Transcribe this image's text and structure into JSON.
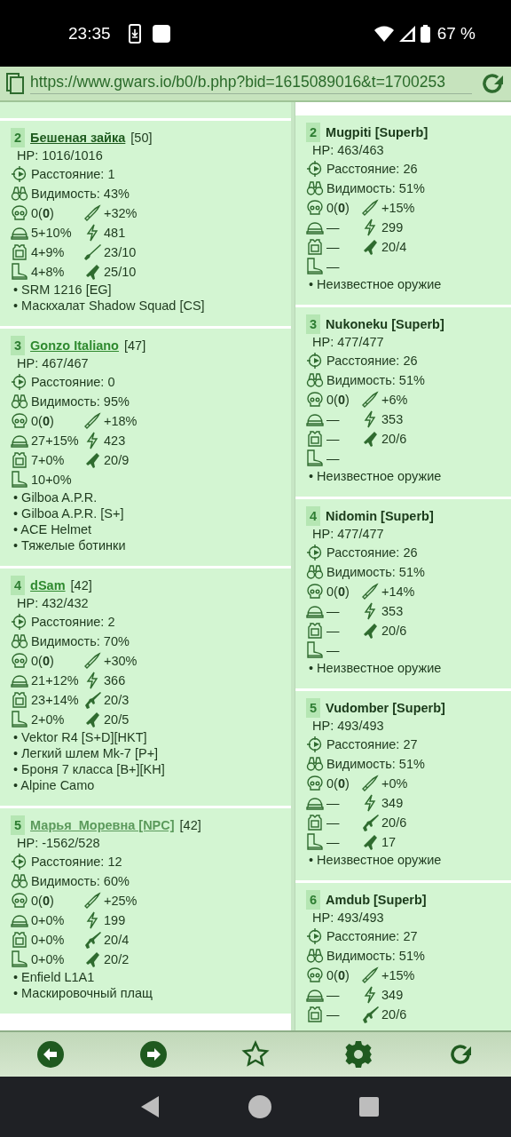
{
  "status_bar": {
    "time": "23:35",
    "battery": "67 %"
  },
  "address_bar": {
    "url": "https://www.gwars.io/b0/b.php?bid=1615089016&t=1700253"
  },
  "columns": [
    {
      "cards": [
        {
          "number": "2",
          "name": "Бешеная зайка",
          "kind": "visited_link",
          "level": "[50]",
          "hp": "HP: 1016/1016",
          "rows": [
            [
              {
                "kind": "crosshair",
                "text": "Расстояние: 1"
              }
            ],
            [
              {
                "kind": "binoculars",
                "text": "Видимость: 43%"
              }
            ],
            [
              {
                "kind": "skull",
                "text": "0(**0**)"
              },
              {
                "kind": "bullet",
                "text": "+32%"
              }
            ],
            [
              {
                "kind": "helmet",
                "text": "5+10%"
              },
              {
                "kind": "lightning",
                "text": "481"
              }
            ],
            [
              {
                "kind": "vest",
                "text": "4+9%"
              },
              {
                "kind": "shotgun",
                "text": "23/10"
              }
            ],
            [
              {
                "kind": "boot",
                "text": "4+8%"
              },
              {
                "kind": "pistol",
                "text": "25/10"
              }
            ]
          ],
          "items": [
            "• SRM 1216 [EG]",
            "• Маскхалат Shadow Squad [CS]"
          ]
        },
        {
          "number": "3",
          "name": "Gonzo Italiano",
          "kind": "link",
          "level": "[47]",
          "hp": "HP: 467/467",
          "rows": [
            [
              {
                "kind": "crosshair",
                "text": "Расстояние: 0"
              }
            ],
            [
              {
                "kind": "binoculars",
                "text": "Видимость: 95%"
              }
            ],
            [
              {
                "kind": "skull",
                "text": "0(**0**)"
              },
              {
                "kind": "bullet",
                "text": "+18%"
              }
            ],
            [
              {
                "kind": "helmet",
                "text": "27+15%"
              },
              {
                "kind": "lightning",
                "text": "423"
              }
            ],
            [
              {
                "kind": "vest",
                "text": "7+0%"
              },
              {
                "kind": "pistol",
                "text": "20/9"
              }
            ],
            [
              {
                "kind": "boot",
                "text": "10+0%"
              }
            ]
          ],
          "items": [
            "• Gilboa A.P.R.",
            "• Gilboa A.P.R. [S+]",
            "• ACE Helmet",
            "• Тяжелые ботинки"
          ]
        },
        {
          "number": "4",
          "name": "dSam",
          "kind": "link",
          "level": "[42]",
          "hp": "HP: 432/432",
          "rows": [
            [
              {
                "kind": "crosshair",
                "text": "Расстояние: 2"
              }
            ],
            [
              {
                "kind": "binoculars",
                "text": "Видимость: 70%"
              }
            ],
            [
              {
                "kind": "skull",
                "text": "0(**0**)"
              },
              {
                "kind": "bullet",
                "text": "+30%"
              }
            ],
            [
              {
                "kind": "helmet",
                "text": "21+12%"
              },
              {
                "kind": "lightning",
                "text": "366"
              }
            ],
            [
              {
                "kind": "vest",
                "text": "23+14%"
              },
              {
                "kind": "rifle",
                "text": "20/3"
              }
            ],
            [
              {
                "kind": "boot",
                "text": "2+0%"
              },
              {
                "kind": "pistol",
                "text": "20/5"
              }
            ]
          ],
          "items": [
            "• Vektor R4 [S+D][HKT]",
            "• Легкий шлем Mk-7 [P+]",
            "• Броня 7 класса [B+][KH]",
            "• Alpine Camo"
          ]
        },
        {
          "number": "5",
          "name": "Марья_Моревна [NPC]",
          "kind": "npc_link",
          "level": "[42]",
          "hp": "HP: -1562/528",
          "rows": [
            [
              {
                "kind": "crosshair",
                "text": "Расстояние: 12"
              }
            ],
            [
              {
                "kind": "binoculars",
                "text": "Видимость: 60%"
              }
            ],
            [
              {
                "kind": "skull",
                "text": "0(**0**)"
              },
              {
                "kind": "bullet",
                "text": "+25%"
              }
            ],
            [
              {
                "kind": "helmet",
                "text": "0+0%"
              },
              {
                "kind": "lightning",
                "text": "199"
              }
            ],
            [
              {
                "kind": "vest",
                "text": "0+0%"
              },
              {
                "kind": "rifle",
                "text": "20/4"
              }
            ],
            [
              {
                "kind": "boot",
                "text": "0+0%"
              },
              {
                "kind": "pistol",
                "text": "20/2"
              }
            ]
          ],
          "items": [
            "• Enfield L1A1",
            "• Маскировочный плащ"
          ]
        }
      ]
    },
    {
      "cards": [
        {
          "number": "2",
          "name": "Mugpiti [Superb]",
          "kind": "plain",
          "hp": "HP: 463/463",
          "rows": [
            [
              {
                "kind": "crosshair",
                "text": "Расстояние: 26"
              }
            ],
            [
              {
                "kind": "binoculars",
                "text": "Видимость: 51%"
              }
            ],
            [
              {
                "kind": "skull",
                "text": "0(**0**)"
              },
              {
                "kind": "bullet",
                "text": "+15%"
              }
            ],
            [
              {
                "kind": "helmet",
                "text": "—"
              },
              {
                "kind": "lightning",
                "text": "299"
              }
            ],
            [
              {
                "kind": "vest",
                "text": "—"
              },
              {
                "kind": "pistol",
                "text": "20/4"
              }
            ],
            [
              {
                "kind": "boot",
                "text": "—"
              }
            ]
          ],
          "items": [
            "• Неизвестное оружие"
          ]
        },
        {
          "number": "3",
          "name": "Nukoneku [Superb]",
          "kind": "plain",
          "hp": "HP: 477/477",
          "rows": [
            [
              {
                "kind": "crosshair",
                "text": "Расстояние: 26"
              }
            ],
            [
              {
                "kind": "binoculars",
                "text": "Видимость: 51%"
              }
            ],
            [
              {
                "kind": "skull",
                "text": "0(**0**)"
              },
              {
                "kind": "bullet",
                "text": "+6%"
              }
            ],
            [
              {
                "kind": "helmet",
                "text": "—"
              },
              {
                "kind": "lightning",
                "text": "353"
              }
            ],
            [
              {
                "kind": "vest",
                "text": "—"
              },
              {
                "kind": "pistol",
                "text": "20/6"
              }
            ],
            [
              {
                "kind": "boot",
                "text": "—"
              }
            ]
          ],
          "items": [
            "• Неизвестное оружие"
          ]
        },
        {
          "number": "4",
          "name": "Nidomin [Superb]",
          "kind": "plain",
          "hp": "HP: 477/477",
          "rows": [
            [
              {
                "kind": "crosshair",
                "text": "Расстояние: 26"
              }
            ],
            [
              {
                "kind": "binoculars",
                "text": "Видимость: 51%"
              }
            ],
            [
              {
                "kind": "skull",
                "text": "0(**0**)"
              },
              {
                "kind": "bullet",
                "text": "+14%"
              }
            ],
            [
              {
                "kind": "helmet",
                "text": "—"
              },
              {
                "kind": "lightning",
                "text": "353"
              }
            ],
            [
              {
                "kind": "vest",
                "text": "—"
              },
              {
                "kind": "pistol",
                "text": "20/6"
              }
            ],
            [
              {
                "kind": "boot",
                "text": "—"
              }
            ]
          ],
          "items": [
            "• Неизвестное оружие"
          ]
        },
        {
          "number": "5",
          "name": "Vudomber [Superb]",
          "kind": "plain",
          "hp": "HP: 493/493",
          "rows": [
            [
              {
                "kind": "crosshair",
                "text": "Расстояние: 27"
              }
            ],
            [
              {
                "kind": "binoculars",
                "text": "Видимость: 51%"
              }
            ],
            [
              {
                "kind": "skull",
                "text": "0(**0**)"
              },
              {
                "kind": "bullet",
                "text": "+0%"
              }
            ],
            [
              {
                "kind": "helmet",
                "text": "—"
              },
              {
                "kind": "lightning",
                "text": "349"
              }
            ],
            [
              {
                "kind": "vest",
                "text": "—"
              },
              {
                "kind": "rifle",
                "text": "20/6"
              }
            ],
            [
              {
                "kind": "boot",
                "text": "—"
              },
              {
                "kind": "pistol",
                "text": "17"
              }
            ]
          ],
          "items": [
            "• Неизвестное оружие"
          ]
        },
        {
          "number": "6",
          "name": "Amdub [Superb]",
          "kind": "plain",
          "hp": "HP: 493/493",
          "rows": [
            [
              {
                "kind": "crosshair",
                "text": "Расстояние: 27"
              }
            ],
            [
              {
                "kind": "binoculars",
                "text": "Видимость: 51%"
              }
            ],
            [
              {
                "kind": "skull",
                "text": "0(**0**)"
              },
              {
                "kind": "bullet",
                "text": "+15%"
              }
            ],
            [
              {
                "kind": "helmet",
                "text": "—"
              },
              {
                "kind": "lightning",
                "text": "349"
              }
            ],
            [
              {
                "kind": "vest",
                "text": "—"
              },
              {
                "kind": "rifle",
                "text": "20/6"
              }
            ]
          ]
        }
      ]
    }
  ],
  "toolbar": [
    {
      "kind": "back"
    },
    {
      "kind": "forward"
    },
    {
      "kind": "star"
    },
    {
      "kind": "settings"
    },
    {
      "kind": "reload"
    }
  ]
}
